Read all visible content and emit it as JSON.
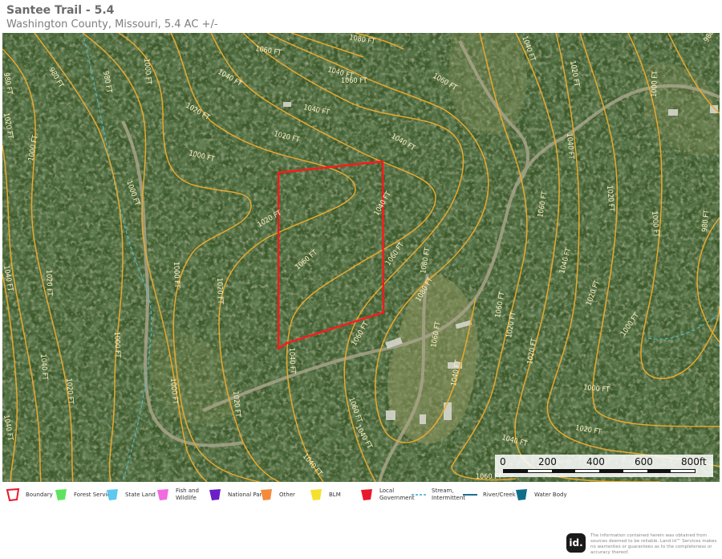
{
  "header": {
    "title": "Santee Trail - 5.4",
    "subtitle": "Washington County, Missouri, 5.4 AC +/-"
  },
  "map": {
    "contour_color": "#e8a92e",
    "boundary_color": "#ff1a1a",
    "stream_color": "#4fc3d6",
    "contour_labels": [
      {
        "text": "980 FT"
      },
      {
        "text": "1080 FT"
      },
      {
        "text": "1060 FT"
      },
      {
        "text": "1040 FT"
      },
      {
        "text": "1020 FT"
      },
      {
        "text": "1000 FT"
      },
      {
        "text": "980 FT"
      },
      {
        "text": "1020 FT"
      },
      {
        "text": "1040 FT"
      },
      {
        "text": "1060 FT"
      },
      {
        "text": "1000 FT"
      },
      {
        "text": "1000 FT"
      },
      {
        "text": "980 FT"
      },
      {
        "text": "1020 FT"
      },
      {
        "text": "1040 FT"
      },
      {
        "text": "1040 FT"
      },
      {
        "text": "1060 FT"
      },
      {
        "text": "1060 FT"
      },
      {
        "text": "1080 FT"
      },
      {
        "text": "1060 FT"
      },
      {
        "text": "1040 FT"
      },
      {
        "text": "1020 FT"
      },
      {
        "text": "1000 FT"
      },
      {
        "text": "1060 FT"
      },
      {
        "text": "1040 FT"
      },
      {
        "text": "1020 FT"
      },
      {
        "text": "1000 FT"
      },
      {
        "text": "1000 FT"
      },
      {
        "text": "1020 FT"
      },
      {
        "text": "1040 FT"
      },
      {
        "text": "1060 FT"
      },
      {
        "text": "1040 FT"
      },
      {
        "text": "1020 FT"
      },
      {
        "text": "1000 FT"
      },
      {
        "text": "1020 FT"
      },
      {
        "text": "980 FT"
      },
      {
        "text": "1000 FT"
      },
      {
        "text": "1000 FT"
      },
      {
        "text": "1020 FT"
      },
      {
        "text": "1040 FT"
      },
      {
        "text": "1060 FT"
      },
      {
        "text": "1080 FT"
      },
      {
        "text": "1060 FT"
      },
      {
        "text": "1020 FT"
      },
      {
        "text": "1040 FT"
      },
      {
        "text": "1040 FT"
      },
      {
        "text": "1020 FT"
      },
      {
        "text": "1000 FT"
      },
      {
        "text": "980 FT"
      },
      {
        "text": "1040 FT"
      },
      {
        "text": "1020 FT"
      },
      {
        "text": "1000 FT"
      },
      {
        "text": "1040 FT"
      },
      {
        "text": "1020 FT"
      },
      {
        "text": "1060 FT"
      },
      {
        "text": "1020 FT"
      },
      {
        "text": "1040 FT"
      },
      {
        "text": "1040 FT"
      },
      {
        "text": "1060 FT"
      },
      {
        "text": "1040 FT"
      }
    ]
  },
  "scalebar": {
    "labels": [
      "0",
      "200",
      "400",
      "600",
      "800ft"
    ]
  },
  "legend": {
    "items": [
      {
        "label": "Boundary",
        "color": "#e8192c",
        "shape": "outline",
        "icon": "boundary-icon"
      },
      {
        "label": "Forest Servic",
        "color": "#5ee35e",
        "shape": "fill",
        "icon": "forest-service-icon"
      },
      {
        "label": "State Land",
        "color": "#5ec8f0",
        "shape": "fill",
        "icon": "state-land-icon"
      },
      {
        "label": "Fish and Wildlife",
        "color": "#f16ae0",
        "shape": "fill",
        "icon": "fish-wildlife-icon"
      },
      {
        "label": "National Parl",
        "color": "#6c1fc9",
        "shape": "fill",
        "icon": "national-park-icon"
      },
      {
        "label": "Other",
        "color": "#f58a3c",
        "shape": "fill",
        "icon": "other-land-icon"
      },
      {
        "label": "BLM",
        "color": "#f5e02e",
        "shape": "fill",
        "icon": "blm-icon"
      },
      {
        "label": "Local Government",
        "color": "#e8192c",
        "shape": "fill",
        "icon": "local-government-icon"
      },
      {
        "label": "Stream, Intermittent",
        "color": "#3aa7c4",
        "shape": "dash",
        "icon": "stream-intermittent-icon"
      },
      {
        "label": "River/Creek",
        "color": "#1e6f8e",
        "shape": "line",
        "icon": "river-creek-icon"
      },
      {
        "label": "Water Body",
        "color": "#0f6f8a",
        "shape": "fill",
        "icon": "water-body-icon"
      }
    ]
  },
  "footer": {
    "logo_text": "id.",
    "disclaimer": "The information contained herein was obtained from sources deemed to be reliable. Land id™ Services makes no warranties or guarantees as to the completeness or accuracy thereof."
  }
}
